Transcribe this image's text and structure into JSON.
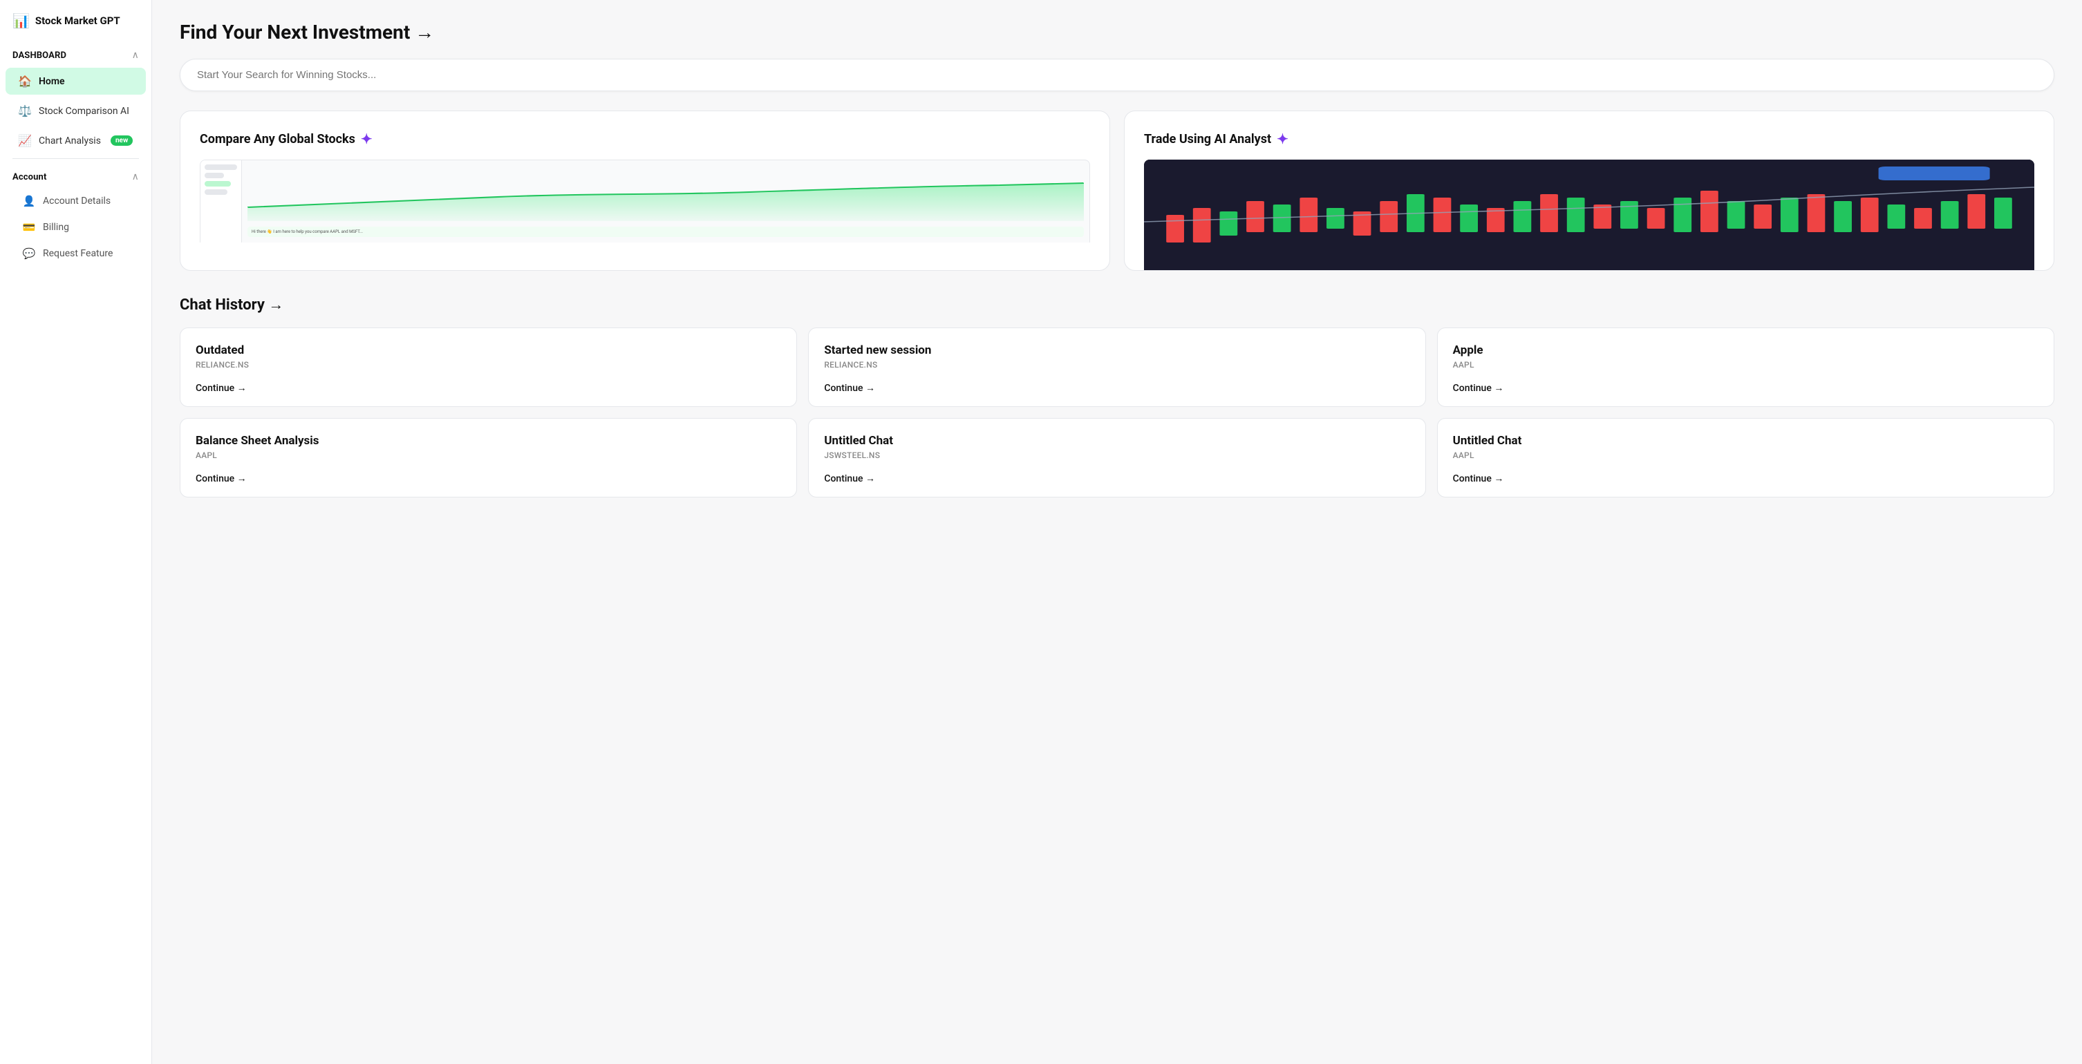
{
  "app": {
    "name": "Stock Market GPT",
    "logo_icon": "📊"
  },
  "sidebar": {
    "dashboard_section": "DASHBOARD",
    "account_section": "Account",
    "nav_items": [
      {
        "id": "home",
        "label": "Home",
        "icon": "🏠",
        "active": true,
        "badge": null
      },
      {
        "id": "stock-comparison",
        "label": "Stock Comparison AI",
        "icon": "⚖️",
        "active": false,
        "badge": null
      },
      {
        "id": "chart-analysis",
        "label": "Chart Analysis",
        "icon": "📈",
        "active": false,
        "badge": "new"
      }
    ],
    "account_items": [
      {
        "id": "account-details",
        "label": "Account Details",
        "icon": "👤"
      },
      {
        "id": "billing",
        "label": "Billing",
        "icon": "💳"
      },
      {
        "id": "request-feature",
        "label": "Request Feature",
        "icon": "💬"
      }
    ]
  },
  "main": {
    "page_title": "Find Your Next Investment →",
    "search_placeholder": "Start Your Search for Winning Stocks...",
    "feature_cards": [
      {
        "id": "compare",
        "title": "Compare Any Global Stocks",
        "has_sparkle": true
      },
      {
        "id": "trade",
        "title": "Trade Using AI Analyst",
        "has_sparkle": true
      }
    ],
    "chat_history_title": "Chat History →",
    "chat_cards": [
      {
        "id": "outdated",
        "title": "Outdated",
        "subtitle": "RELIANCE.NS",
        "continue_label": "Continue →"
      },
      {
        "id": "started-new",
        "title": "Started new session",
        "subtitle": "RELIANCE.NS",
        "continue_label": "Continue →"
      },
      {
        "id": "apple",
        "title": "Apple",
        "subtitle": "AAPL",
        "continue_label": "Continue →"
      },
      {
        "id": "balance-sheet",
        "title": "Balance Sheet Analysis",
        "subtitle": "AAPL",
        "continue_label": "Continue →"
      },
      {
        "id": "untitled-chat-1",
        "title": "Untitled Chat",
        "subtitle": "JSWSTEEL.NS",
        "continue_label": "Continue →"
      },
      {
        "id": "untitled-chat-2",
        "title": "Untitled Chat",
        "subtitle": "AAPL",
        "continue_label": "Continue →"
      }
    ]
  }
}
